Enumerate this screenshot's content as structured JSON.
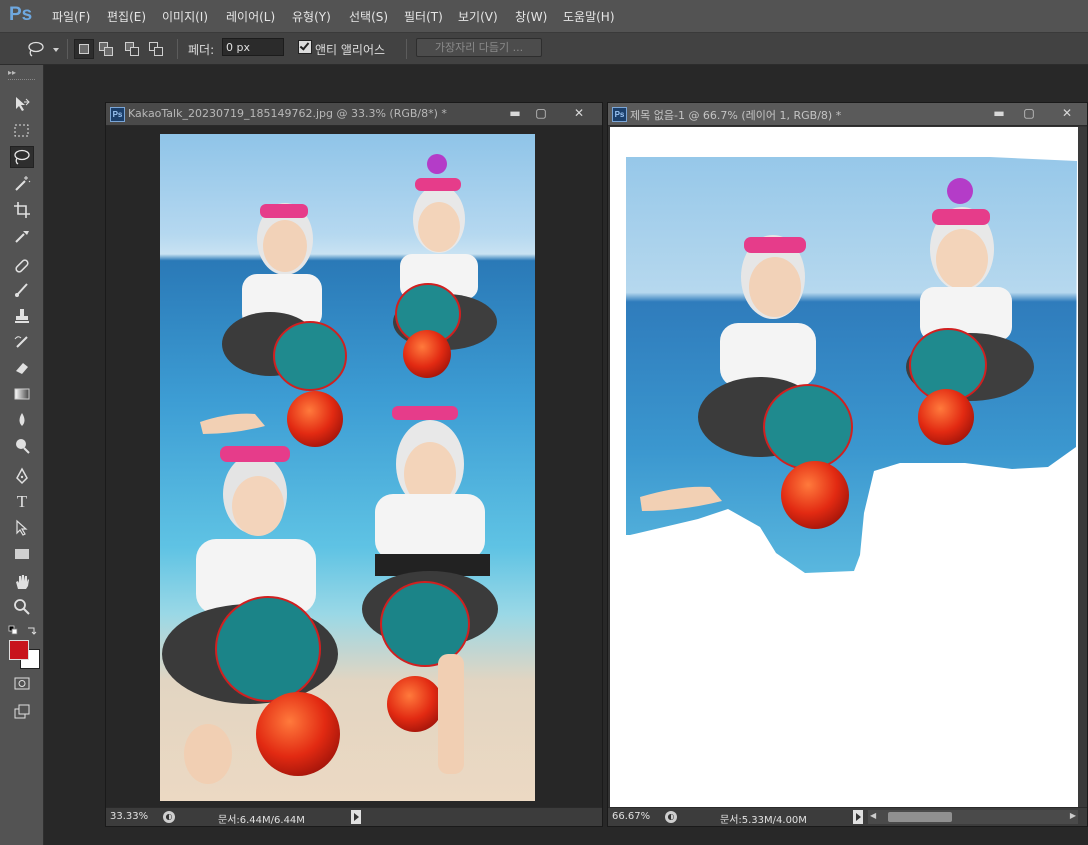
{
  "app": {
    "logo": "Ps"
  },
  "menu": [
    "파일(F)",
    "편집(E)",
    "이미지(I)",
    "레이어(L)",
    "유형(Y)",
    "선택(S)",
    "필터(T)",
    "보기(V)",
    "창(W)",
    "도움말(H)"
  ],
  "options": {
    "feather_label": "페더:",
    "feather_value": "0 px",
    "antialias_label": "앤티 앨리어스",
    "antialias_checked": true,
    "refine_edge_label": "가장자리 다듬기 ..."
  },
  "documents": [
    {
      "title": "KakaoTalk_20230719_185149762.jpg @ 33.3% (RGB/8*) *",
      "zoom": "33.33%",
      "doc_info": "문서:6.44M/6.44M"
    },
    {
      "title": "제목 없음-1 @ 66.7% (레이어 1, RGB/8) *",
      "zoom": "66.67%",
      "doc_info": "문서:5.33M/4.00M"
    }
  ],
  "colors": {
    "foreground": "#c8141c",
    "background": "#ffffff"
  }
}
